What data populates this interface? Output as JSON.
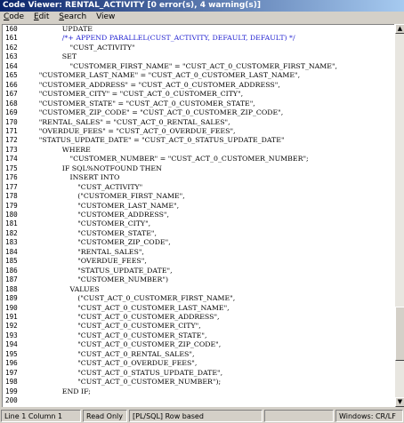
{
  "window": {
    "title": "Code Viewer: RENTAL_ACTIVITY [0 error(s), 4 warning(s)]"
  },
  "menu": [
    {
      "label": "Code",
      "mnemonic": "C",
      "rest": "ode"
    },
    {
      "label": "Edit",
      "mnemonic": "E",
      "rest": "dit"
    },
    {
      "label": "Search",
      "mnemonic": "S",
      "rest": "earch"
    },
    {
      "label": "View",
      "mnemonic": "",
      "rest": "View"
    }
  ],
  "code_lines": [
    {
      "n": "160",
      "indent": 8,
      "text": "UPDATE",
      "comment": false
    },
    {
      "n": "161",
      "indent": 8,
      "text": "/*+ APPEND PARALLEL(CUST_ACTIVITY, DEFAULT, DEFAULT) */",
      "comment": true
    },
    {
      "n": "162",
      "indent": 10,
      "text": "\"CUST_ACTIVITY\"",
      "comment": false
    },
    {
      "n": "163",
      "indent": 8,
      "text": "SET",
      "comment": false
    },
    {
      "n": "164",
      "indent": 10,
      "text": "\"CUSTOMER_FIRST_NAME\" = \"CUST_ACT_0_CUSTOMER_FIRST_NAME\",",
      "comment": false
    },
    {
      "n": "165",
      "indent": 2,
      "text": "\"CUSTOMER_LAST_NAME\" = \"CUST_ACT_0_CUSTOMER_LAST_NAME\",",
      "comment": false
    },
    {
      "n": "166",
      "indent": 2,
      "text": "\"CUSTOMER_ADDRESS\" = \"CUST_ACT_0_CUSTOMER_ADDRESS\",",
      "comment": false
    },
    {
      "n": "167",
      "indent": 2,
      "text": "\"CUSTOMER_CITY\" = \"CUST_ACT_0_CUSTOMER_CITY\",",
      "comment": false
    },
    {
      "n": "168",
      "indent": 2,
      "text": "\"CUSTOMER_STATE\" = \"CUST_ACT_0_CUSTOMER_STATE\",",
      "comment": false
    },
    {
      "n": "169",
      "indent": 2,
      "text": "\"CUSTOMER_ZIP_CODE\" = \"CUST_ACT_0_CUSTOMER_ZIP_CODE\",",
      "comment": false
    },
    {
      "n": "170",
      "indent": 2,
      "text": "\"RENTAL_SALES\" = \"CUST_ACT_0_RENTAL_SALES\",",
      "comment": false
    },
    {
      "n": "171",
      "indent": 2,
      "text": "\"OVERDUE_FEES\" = \"CUST_ACT_0_OVERDUE_FEES\",",
      "comment": false
    },
    {
      "n": "172",
      "indent": 2,
      "text": "\"STATUS_UPDATE_DATE\" = \"CUST_ACT_0_STATUS_UPDATE_DATE\"",
      "comment": false
    },
    {
      "n": "173",
      "indent": 8,
      "text": "WHERE",
      "comment": false
    },
    {
      "n": "174",
      "indent": 10,
      "text": "\"CUSTOMER_NUMBER\" = \"CUST_ACT_0_CUSTOMER_NUMBER\";",
      "comment": false
    },
    {
      "n": "175",
      "indent": 8,
      "text": "IF SQL%NOTFOUND THEN",
      "comment": false
    },
    {
      "n": "176",
      "indent": 10,
      "text": "INSERT INTO",
      "comment": false
    },
    {
      "n": "177",
      "indent": 12,
      "text": "\"CUST_ACTIVITY\"",
      "comment": false
    },
    {
      "n": "178",
      "indent": 12,
      "text": "(\"CUSTOMER_FIRST_NAME\",",
      "comment": false
    },
    {
      "n": "179",
      "indent": 12,
      "text": "\"CUSTOMER_LAST_NAME\",",
      "comment": false
    },
    {
      "n": "180",
      "indent": 12,
      "text": "\"CUSTOMER_ADDRESS\",",
      "comment": false
    },
    {
      "n": "181",
      "indent": 12,
      "text": "\"CUSTOMER_CITY\",",
      "comment": false
    },
    {
      "n": "182",
      "indent": 12,
      "text": "\"CUSTOMER_STATE\",",
      "comment": false
    },
    {
      "n": "183",
      "indent": 12,
      "text": "\"CUSTOMER_ZIP_CODE\",",
      "comment": false
    },
    {
      "n": "184",
      "indent": 12,
      "text": "\"RENTAL_SALES\",",
      "comment": false
    },
    {
      "n": "185",
      "indent": 12,
      "text": "\"OVERDUE_FEES\",",
      "comment": false
    },
    {
      "n": "186",
      "indent": 12,
      "text": "\"STATUS_UPDATE_DATE\",",
      "comment": false
    },
    {
      "n": "187",
      "indent": 12,
      "text": "\"CUSTOMER_NUMBER\")",
      "comment": false
    },
    {
      "n": "188",
      "indent": 10,
      "text": "VALUES",
      "comment": false
    },
    {
      "n": "189",
      "indent": 12,
      "text": "(\"CUST_ACT_0_CUSTOMER_FIRST_NAME\",",
      "comment": false
    },
    {
      "n": "190",
      "indent": 12,
      "text": "\"CUST_ACT_0_CUSTOMER_LAST_NAME\",",
      "comment": false
    },
    {
      "n": "191",
      "indent": 12,
      "text": "\"CUST_ACT_0_CUSTOMER_ADDRESS\",",
      "comment": false
    },
    {
      "n": "192",
      "indent": 12,
      "text": "\"CUST_ACT_0_CUSTOMER_CITY\",",
      "comment": false
    },
    {
      "n": "193",
      "indent": 12,
      "text": "\"CUST_ACT_0_CUSTOMER_STATE\",",
      "comment": false
    },
    {
      "n": "194",
      "indent": 12,
      "text": "\"CUST_ACT_0_CUSTOMER_ZIP_CODE\",",
      "comment": false
    },
    {
      "n": "195",
      "indent": 12,
      "text": "\"CUST_ACT_0_RENTAL_SALES\",",
      "comment": false
    },
    {
      "n": "196",
      "indent": 12,
      "text": "\"CUST_ACT_0_OVERDUE_FEES\",",
      "comment": false
    },
    {
      "n": "197",
      "indent": 12,
      "text": "\"CUST_ACT_0_STATUS_UPDATE_DATE\",",
      "comment": false
    },
    {
      "n": "198",
      "indent": 12,
      "text": "\"CUST_ACT_0_CUSTOMER_NUMBER\");",
      "comment": false
    },
    {
      "n": "199",
      "indent": 8,
      "text": "END IF;",
      "comment": false
    },
    {
      "n": "200",
      "indent": 0,
      "text": "",
      "comment": false
    }
  ],
  "scrollbar": {
    "up_icon": "scroll-up-arrow-icon",
    "down_icon": "scroll-down-arrow-icon",
    "up_glyph": "▲",
    "down_glyph": "▼"
  },
  "status": {
    "position": "Line 1 Column 1",
    "mode": "Read Only",
    "language": "[PL/SQL] Row based",
    "line_endings": "Windows: CR/LF"
  },
  "colors": {
    "title_gradient_start": "#0a246a",
    "title_gradient_end": "#a6caf0",
    "comment_text": "#1f1fd0",
    "chrome": "#d4d0c8"
  }
}
